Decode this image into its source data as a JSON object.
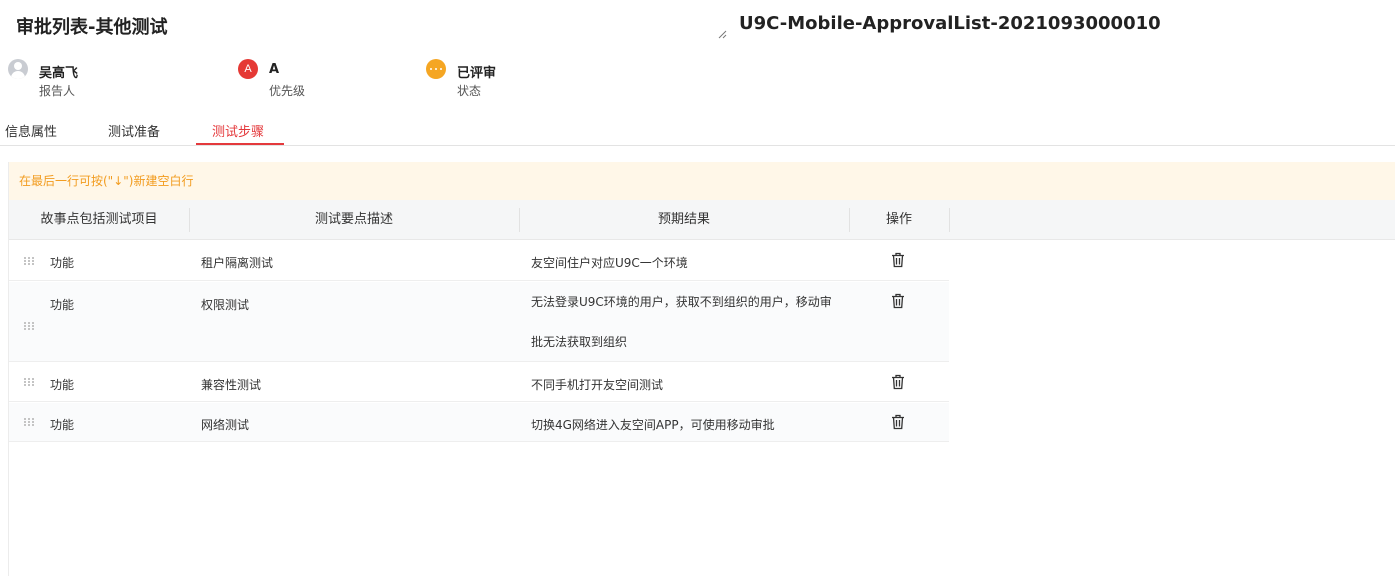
{
  "header": {
    "title": "审批列表-其他测试",
    "code": "U9C-Mobile-ApprovalList-2021093000010"
  },
  "meta": {
    "reporter": {
      "value": "吴高飞",
      "label": "报告人",
      "icon": "user-avatar-icon"
    },
    "priority": {
      "value": "A",
      "badge": "A",
      "label": "优先级",
      "color": "#e53935"
    },
    "status": {
      "value": "已评审",
      "label": "状态",
      "color": "#f5a623"
    }
  },
  "tabs": [
    {
      "label": "信息属性",
      "active": false
    },
    {
      "label": "测试准备",
      "active": false
    },
    {
      "label": "测试步骤",
      "active": true
    }
  ],
  "tip": "在最后一行可按(\"↓\")新建空白行",
  "table": {
    "columns": [
      "故事点包括测试项目",
      "测试要点描述",
      "预期结果",
      "操作"
    ],
    "rows": [
      {
        "item": "功能",
        "point": "租户隔离测试",
        "result": "友空间住户对应U9C一个环境"
      },
      {
        "item": "功能",
        "point": "权限测试",
        "result": "无法登录U9C环境的用户，获取不到组织的用户，移动审批无法获取到组织"
      },
      {
        "item": "功能",
        "point": "兼容性测试",
        "result": "不同手机打开友空间测试"
      },
      {
        "item": "功能",
        "point": "网络测试",
        "result": "切换4G网络进入友空间APP，可使用移动审批"
      }
    ]
  },
  "colors": {
    "accent": "#e4393c",
    "tip_text": "#f29c1f",
    "tip_bg": "#fff7e8"
  }
}
